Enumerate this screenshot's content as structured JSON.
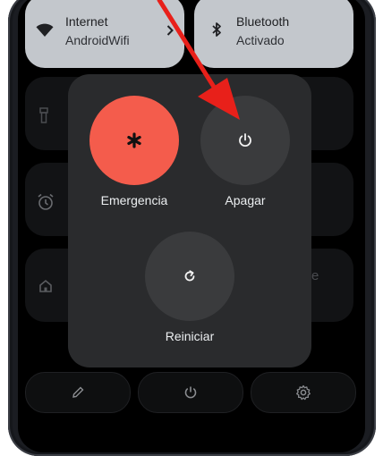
{
  "quick_settings": {
    "internet": {
      "title": "Internet",
      "subtitle": "AndroidWifi"
    },
    "bluetooth": {
      "title": "Bluetooth",
      "subtitle": "Activado"
    }
  },
  "power_menu": {
    "emergency_label": "Emergencia",
    "power_off_label": "Apagar",
    "restart_label": "Reiniciar"
  },
  "background_fragments": {
    "tile_letter": "e"
  },
  "colors": {
    "emergency": "#f45c4c",
    "power_button": "#3a3b3d",
    "arrow": "#e8201a",
    "panel": "#2a2b2d"
  },
  "icons": {
    "internet": "wifi-icon",
    "bluetooth": "bluetooth-icon",
    "emergency": "asterisk-icon",
    "power": "power-icon",
    "restart": "restart-icon",
    "edit": "pencil-icon",
    "settings": "gear-icon"
  }
}
